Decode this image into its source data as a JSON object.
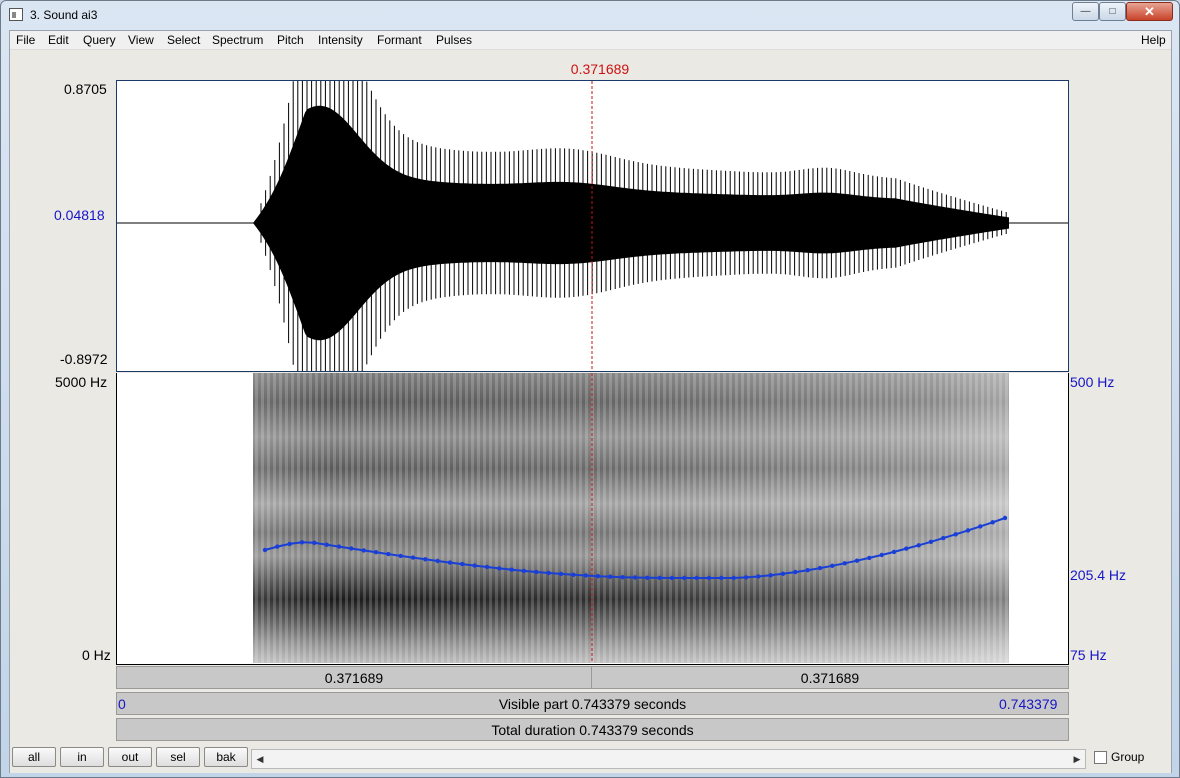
{
  "window": {
    "title": "3. Sound ai3",
    "min_glyph": "—",
    "max_glyph": "□",
    "close_glyph": "✕"
  },
  "menu": {
    "items": [
      "File",
      "Edit",
      "Query",
      "View",
      "Select",
      "Spectrum",
      "Pitch",
      "Intensity",
      "Formant",
      "Pulses"
    ],
    "help": "Help"
  },
  "cursor": {
    "time_label": "0.371689"
  },
  "waveform": {
    "max_label": "0.8705",
    "zero_label": "0.04818",
    "min_label": "-0.8972"
  },
  "spectrogram": {
    "top_freq_label": "5000 Hz",
    "bottom_freq_label": "0 Hz",
    "pitch_top_label": "500 Hz",
    "pitch_cursor_label": "205.4 Hz",
    "pitch_bottom_label": "75 Hz"
  },
  "time_bars": {
    "left_half": "0.371689",
    "right_half": "0.371689",
    "visible_start": "0",
    "visible_end": "0.743379",
    "visible_text": "Visible part 0.743379 seconds",
    "total_text": "Total duration 0.743379 seconds"
  },
  "buttons": {
    "all": "all",
    "in": "in",
    "out": "out",
    "sel": "sel",
    "bak": "bak"
  },
  "scrollbar": {
    "left_arrow": "◀",
    "right_arrow": "▶"
  },
  "group": {
    "label": "Group",
    "checked": false
  },
  "colors": {
    "cursor": "#cc1111",
    "pitch_curve": "#1a3fd6",
    "axis_blue": "#1515c8"
  }
}
